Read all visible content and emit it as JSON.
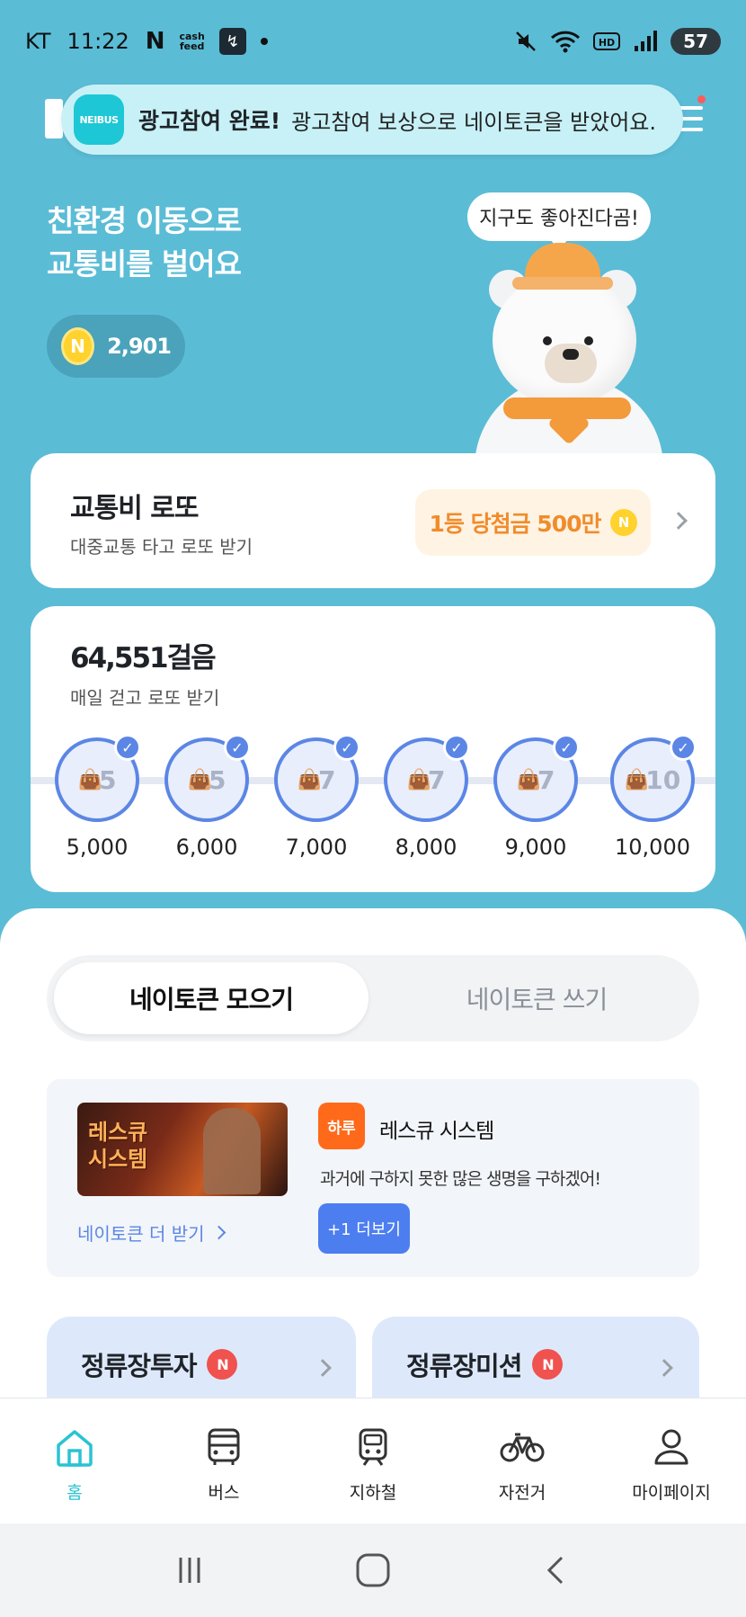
{
  "status_bar": {
    "carrier": "KT",
    "time": "11:22",
    "app_icon_n": "N",
    "app_icon_cashfeed": "cash\nfeed",
    "battery": "57"
  },
  "toast": {
    "logo": "NEIBUS",
    "bold": "광고참여 완료!",
    "text": "광고참여 보상으로 네이토큰을 받았어요."
  },
  "hero": {
    "title": "친환경 이동으로\n교통비를 벌어요",
    "coin_label": "N",
    "points": "2,901",
    "speech": "지구도 좋아진다곰!"
  },
  "lotto": {
    "title": "교통비 로또",
    "subtitle": "대중교통 타고 로또 받기",
    "prize": "1등 당첨금 500만",
    "prize_coin": "N"
  },
  "steps": {
    "title": "64,551걸음",
    "subtitle": "매일 걷고 로또 받기",
    "milestones": [
      {
        "reward": "5",
        "steps": "5,000"
      },
      {
        "reward": "5",
        "steps": "6,000"
      },
      {
        "reward": "7",
        "steps": "7,000"
      },
      {
        "reward": "7",
        "steps": "8,000"
      },
      {
        "reward": "7",
        "steps": "9,000"
      },
      {
        "reward": "10",
        "steps": "10,000"
      }
    ]
  },
  "tabs": {
    "collect": "네이토큰 모으기",
    "spend": "네이토큰 쓰기"
  },
  "ad": {
    "thumb_text": "레스큐\n시스템",
    "logo": "하루",
    "title": "레스큐 시스템",
    "description": "과거에 구하지 못한 많은 생명을 구하겠어!",
    "more_link": "네이토큰 더 받기",
    "button": "+1 더보기"
  },
  "mini_cards": {
    "invest": "정류장투자",
    "mission": "정류장미션",
    "badge": "N"
  },
  "bottom_nav": {
    "home": "홈",
    "bus": "버스",
    "subway": "지하철",
    "bike": "자전거",
    "mypage": "마이페이지"
  },
  "colors": {
    "background": "#5bbcd6",
    "accent": "#5b86e5",
    "active_nav": "#29c3d4",
    "prize_orange": "#f08c2b"
  }
}
